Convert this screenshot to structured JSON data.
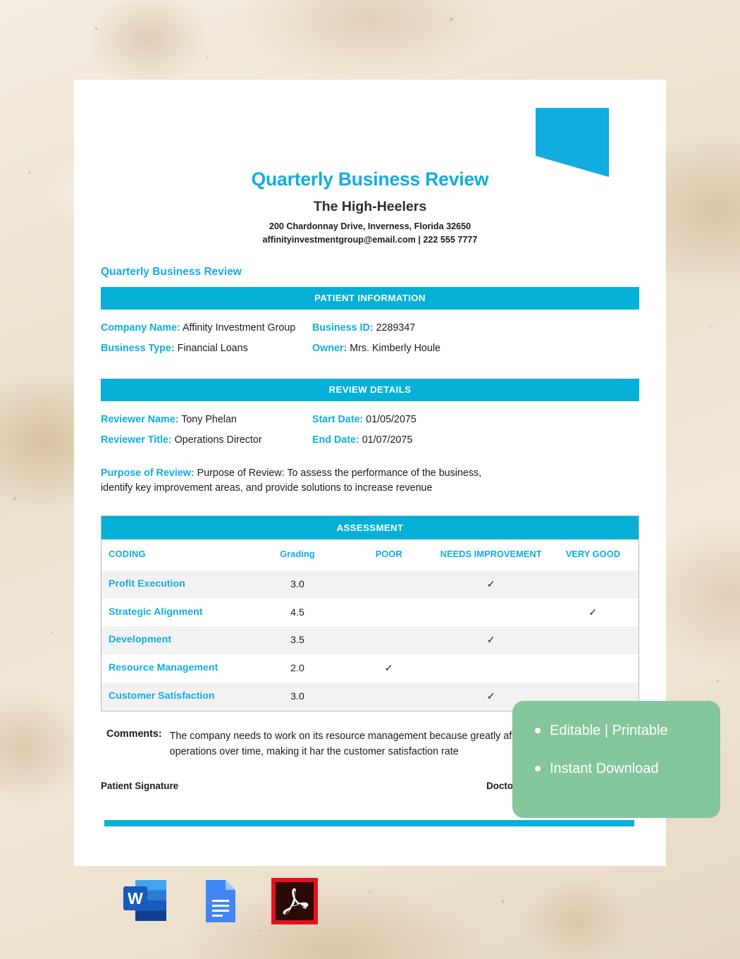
{
  "colors": {
    "accent_cyan": "#11ade0",
    "banner_cyan": "#06b0d6",
    "promo_green": "#84c79c",
    "page_white": "#ffffff",
    "stripe_gray": "#f2f2f2",
    "text_dark": "#1c1c1c"
  },
  "document": {
    "title": "Quarterly Business Review",
    "company_name": "The High-Heelers",
    "address": "200 Chardonnay Drive, Inverness, Florida 32650",
    "contact": "affinityinvestmentgroup@email.com | 222 555 7777",
    "section_title": "Quarterly Business Review"
  },
  "patient_information": {
    "banner": "PATIENT INFORMATION",
    "fields": [
      {
        "label": "Company Name:",
        "value": "Affinity Investment Group"
      },
      {
        "label": "Business ID:",
        "value": "2289347"
      },
      {
        "label": "Business Type:",
        "value": "Financial Loans"
      },
      {
        "label": "Owner:",
        "value": "Mrs. Kimberly Houle"
      }
    ]
  },
  "review_details": {
    "banner": "REVIEW DETAILS",
    "fields": [
      {
        "label": "Reviewer Name:",
        "value": "Tony Phelan"
      },
      {
        "label": "Start Date:",
        "value": "01/05/2075"
      },
      {
        "label": "Reviewer Title:",
        "value": "Operations Director"
      },
      {
        "label": "End Date:",
        "value": "01/07/2075"
      }
    ],
    "purpose_label": "Purpose of Review:",
    "purpose_text": "Purpose of Review: To assess the performance of the business, identify key improvement areas, and provide solutions to increase revenue"
  },
  "assessment": {
    "banner": "ASSESSMENT",
    "columns": [
      "CODING",
      "Grading",
      "POOR",
      "NEEDS IMPROVEMENT",
      "VERY GOOD"
    ],
    "check_glyph": "✓",
    "rows": [
      {
        "coding": "Profit Execution",
        "grading": "3.0",
        "poor": "",
        "needs_improvement": "✓",
        "very_good": ""
      },
      {
        "coding": "Strategic Alignment",
        "grading": "4.5",
        "poor": "",
        "needs_improvement": "",
        "very_good": "✓"
      },
      {
        "coding": "Development",
        "grading": "3.5",
        "poor": "",
        "needs_improvement": "✓",
        "very_good": ""
      },
      {
        "coding": "Resource Management",
        "grading": "2.0",
        "poor": "✓",
        "needs_improvement": "",
        "very_good": ""
      },
      {
        "coding": "Customer Satisfaction",
        "grading": "3.0",
        "poor": "",
        "needs_improvement": "✓",
        "very_good": ""
      }
    ]
  },
  "comments": {
    "label": "Comments:",
    "text": "The company needs to work on its resource management because greatly affect the company’s operations over time, making it har the customer satisfaction rate"
  },
  "signatures": {
    "patient": "Patient Signature",
    "doctor": "Doctor’s Sig"
  },
  "promo": {
    "line1": "Editable | Printable",
    "line2": "Instant Download"
  },
  "file_formats": [
    {
      "name": "microsoft-word",
      "letter": "W"
    },
    {
      "name": "google-docs",
      "letter": ""
    },
    {
      "name": "adobe-pdf",
      "letter": ""
    }
  ]
}
